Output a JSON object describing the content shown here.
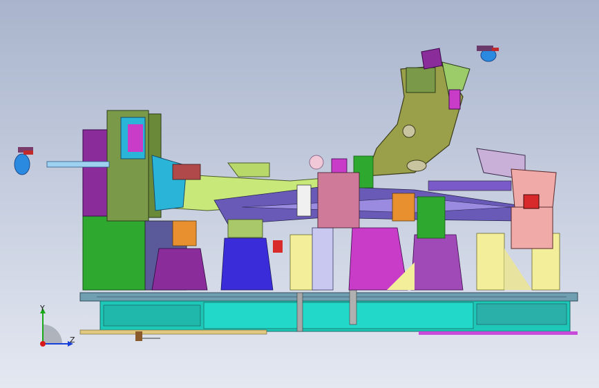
{
  "viewport": {
    "background_top": "#a9b4cc",
    "background_bottom": "#e4e8f1",
    "model": "welding-fixture-assembly"
  },
  "triad": {
    "y_label": "Y",
    "z_label": "Z",
    "y_color": "#18a818",
    "z_color": "#1840d8",
    "x_color": "#d81818"
  },
  "colors": {
    "base_plate": "#1ec8b8",
    "base_rail": "#2aa69a",
    "main_arm": "#c8e87a",
    "curved_arm": "#9aa04a",
    "riser_green": "#2ea82e",
    "riser_purple": "#8a2c9a",
    "block_cyan": "#2ab4d8",
    "block_magenta": "#c83cc8",
    "block_yellow": "#f2ee9a",
    "block_pink": "#f0aaa8",
    "block_orange": "#e89030"
  }
}
